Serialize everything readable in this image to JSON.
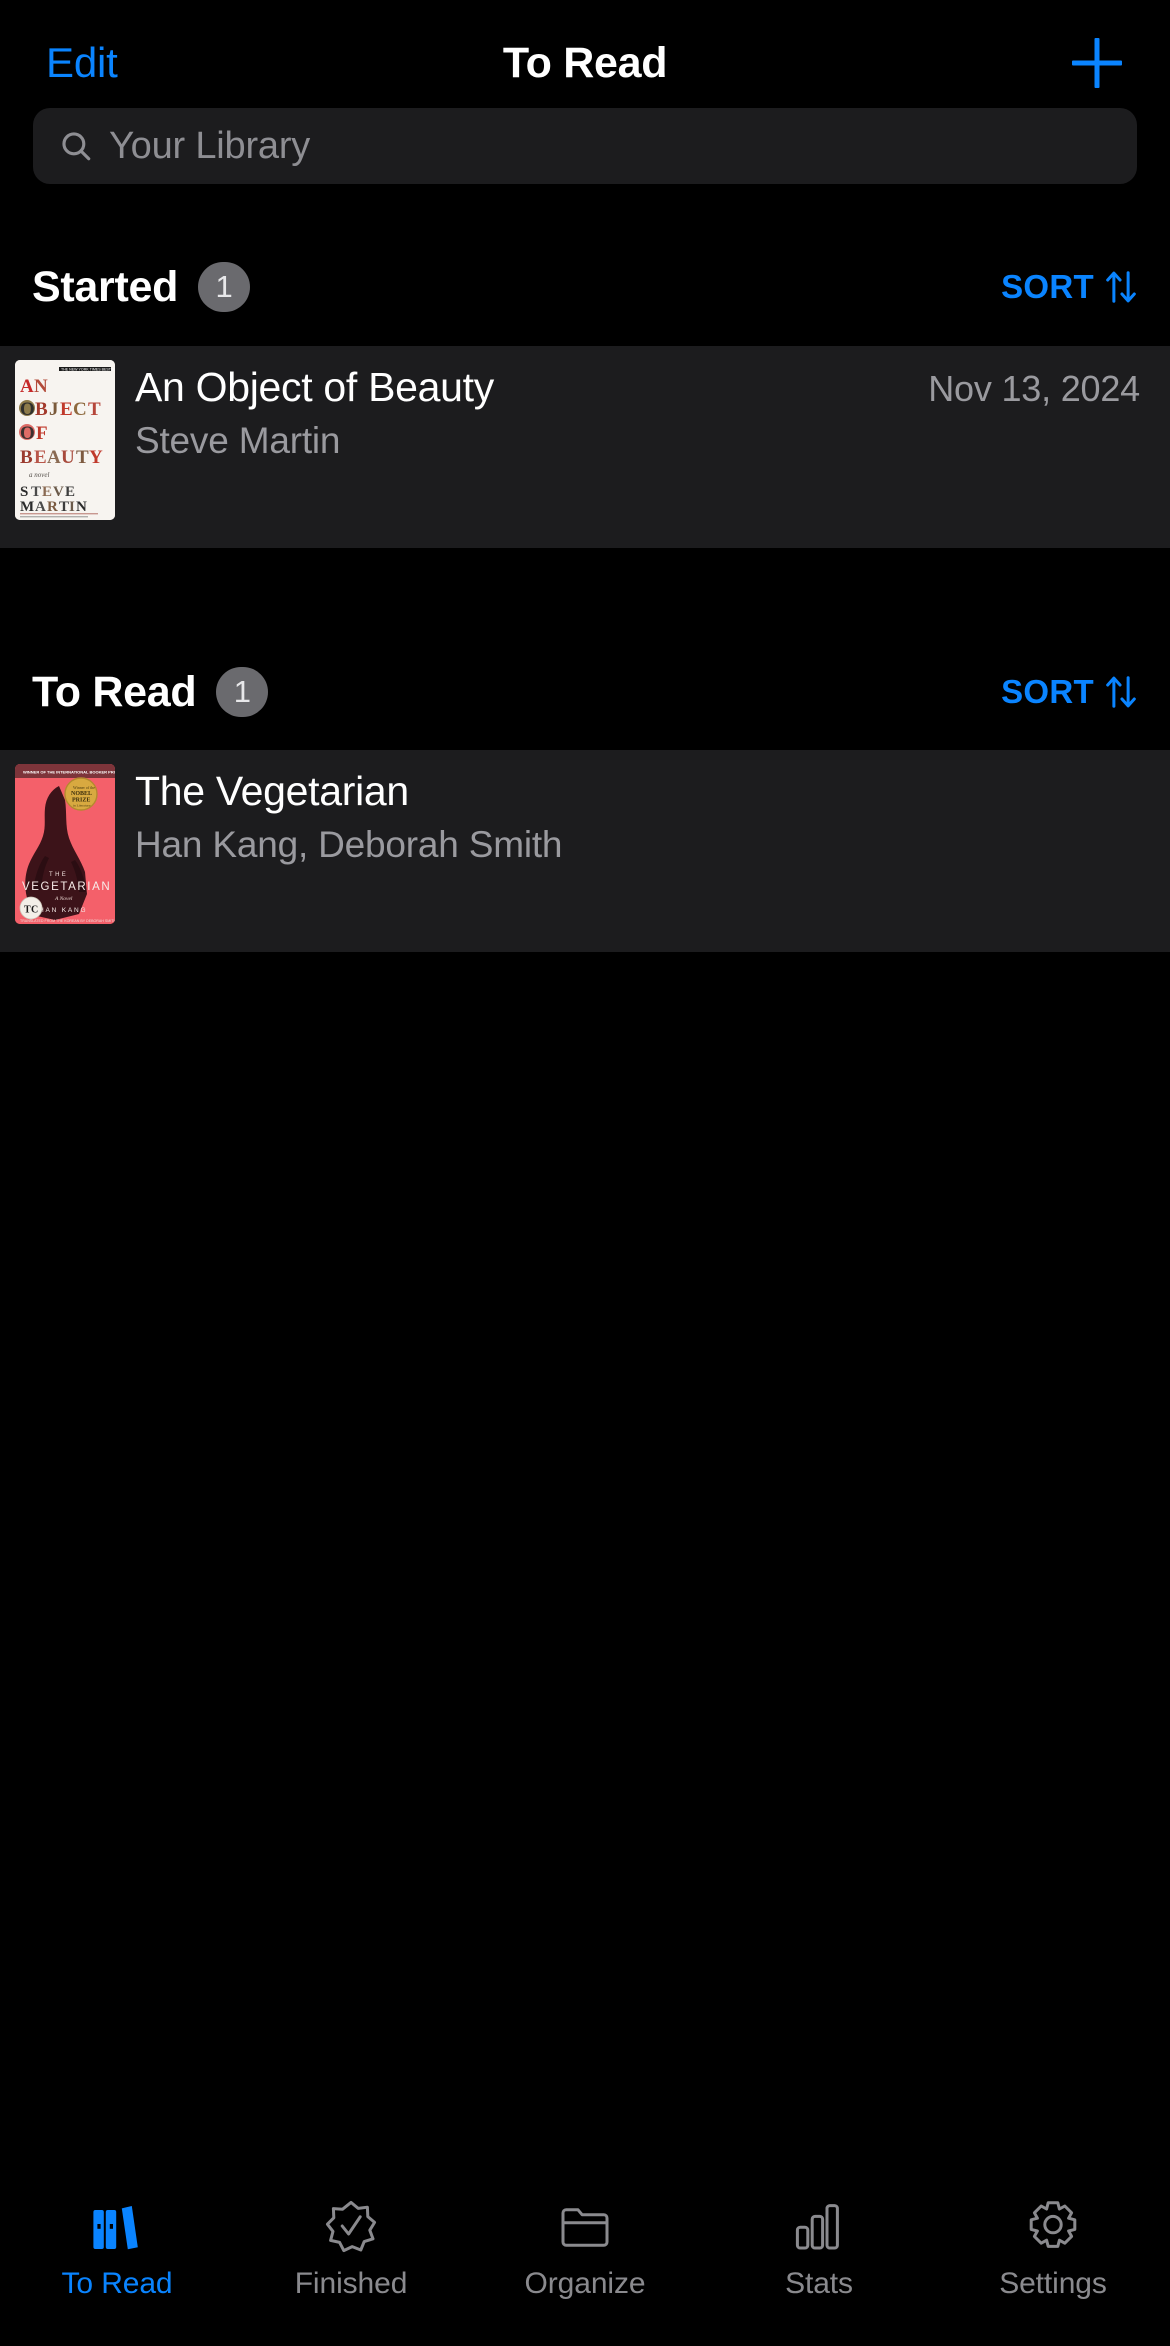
{
  "navbar": {
    "edit_label": "Edit",
    "title": "To Read",
    "add_icon": "plus-icon"
  },
  "search": {
    "placeholder": "Your Library",
    "value": "",
    "icon": "search-icon"
  },
  "sections": [
    {
      "title": "Started",
      "count": "1",
      "sort_label": "SORT",
      "sort_icon": "sort-updown-icon",
      "books": [
        {
          "title": "An Object of Beauty",
          "author": "Steve Martin",
          "date": "Nov 13, 2024",
          "cover_alt": "An Object of Beauty cover"
        }
      ]
    },
    {
      "title": "To Read",
      "count": "1",
      "sort_label": "SORT",
      "sort_icon": "sort-updown-icon",
      "books": [
        {
          "title": "The Vegetarian",
          "author": "Han Kang, Deborah Smith",
          "date": "",
          "cover_alt": "The Vegetarian cover"
        }
      ]
    }
  ],
  "tabbar": {
    "items": [
      {
        "label": "To Read",
        "icon": "books-icon",
        "active": true
      },
      {
        "label": "Finished",
        "icon": "seal-checkmark-icon",
        "active": false
      },
      {
        "label": "Organize",
        "icon": "folder-icon",
        "active": false
      },
      {
        "label": "Stats",
        "icon": "barchart-icon",
        "active": false
      },
      {
        "label": "Settings",
        "icon": "gear-icon",
        "active": false
      }
    ]
  },
  "colors": {
    "accent": "#0a84ff",
    "background": "#000000",
    "row_background": "#1c1c1e",
    "secondary_text": "#9a9a9f",
    "badge": "#6a6a6e"
  }
}
